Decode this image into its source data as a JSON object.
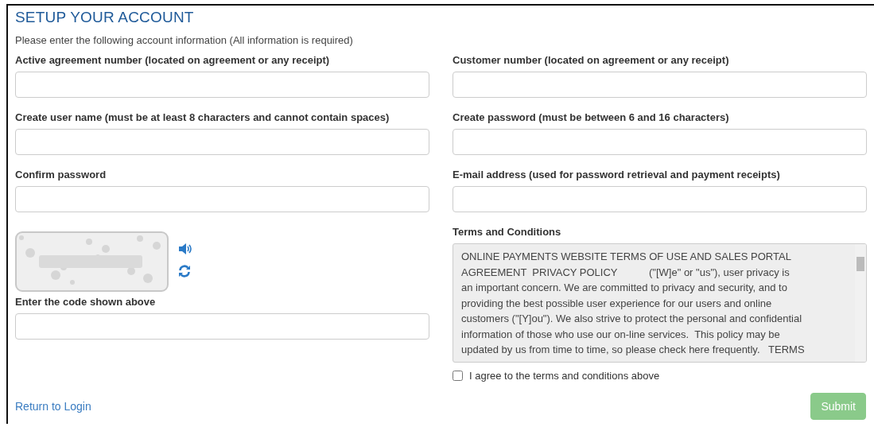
{
  "title": "SETUP YOUR ACCOUNT",
  "intro": "Please enter the following account information (All information is required)",
  "fields": [
    {
      "label": "Active agreement number (located on agreement or any receipt)"
    },
    {
      "label": "Customer number (located on agreement or any receipt)"
    },
    {
      "label": "Create user name (must be at least 8 characters and cannot contain spaces)"
    },
    {
      "label": "Create password (must be between 6 and 16 characters)"
    },
    {
      "label": "Confirm password"
    },
    {
      "label": "E-mail address (used for password retrieval and payment receipts)"
    }
  ],
  "captcha": {
    "kind": "picture",
    "code_label": "Enter the code shown above"
  },
  "terms": {
    "label": "Terms and Conditions",
    "lines": [
      "ONLINE PAYMENTS WEBSITE TERMS OF USE AND SALES PORTAL",
      "AGREEMENT  PRIVACY POLICY           (\"[W]e\" or \"us\"), user privacy is",
      "an important concern. We are committed to privacy and security, and to",
      "providing the best possible user experience for our users and online",
      "customers (\"[Y]ou\"). We also strive to protect the personal and confidential",
      "information of those who use our on-line services.  This policy may be",
      "updated by us from time to time, so please check here frequently.   TERMS"
    ]
  },
  "agree": {
    "label": "I agree to the terms and conditions above",
    "checked": false
  },
  "return_link": "Return to Login",
  "submit": {
    "label": "Submit",
    "disabled": true
  }
}
